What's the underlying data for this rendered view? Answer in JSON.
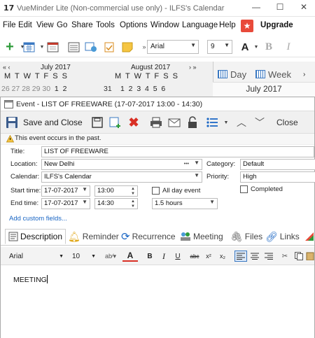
{
  "app": {
    "logo": "17",
    "title": "VueMinder Lite (Non-commercial use only) - ILFS's Calendar",
    "controls": {
      "minimize": "—",
      "maximize": "☐",
      "close": "✕"
    }
  },
  "menu": {
    "items": [
      "File",
      "Edit",
      "View",
      "Go",
      "Share",
      "Tools",
      "Options",
      "Window",
      "Language",
      "Help"
    ],
    "upgrade": "Upgrade",
    "upgrade_color": "#e84a3a"
  },
  "toolbar": {
    "font": "Arial",
    "size": "9",
    "font_color_label": "A",
    "bold_label": "B",
    "italic_label": "I"
  },
  "minical": {
    "months": [
      {
        "title": "July 2017",
        "dow": "M T W T F S S",
        "dates_dim": "26 27 28 29 30",
        "dates": "1  2"
      },
      {
        "title": "August 2017",
        "dow": "M T W T F S S",
        "dates_lead": "31",
        "dates": "1  2  3  4  5  6"
      }
    ],
    "nav_prev": "«  ‹",
    "nav_next": "›  »"
  },
  "view": {
    "day": "Day",
    "week": "Week",
    "month_label": "July 2017"
  },
  "event": {
    "window_title": "Event - LIST OF FREEWARE (17-07-2017 13:00 - 14:30)",
    "toolbar": {
      "save_close": "Save and Close",
      "close": "Close"
    },
    "warning": "This event occurs in the past.",
    "labels": {
      "title": "Title:",
      "location": "Location:",
      "calendar": "Calendar:",
      "start": "Start time:",
      "end": "End time:",
      "category": "Category:",
      "priority": "Priority:",
      "all_day": "All day event",
      "completed": "Completed",
      "add_custom": "Add custom fields..."
    },
    "values": {
      "title": "LIST OF FREEWARE",
      "location": "New Delhi",
      "location_more": "•••",
      "calendar": "ILFS's Calendar",
      "start_date": "17-07-2017",
      "start_time": "13:00",
      "end_date": "17-07-2017",
      "end_time": "14:30",
      "duration": "1.5 hours",
      "category": "Default",
      "priority": "High"
    },
    "tabs": [
      "Description",
      "Reminder",
      "Recurrence",
      "Meeting",
      "Files",
      "Links"
    ],
    "format": {
      "font": "Arial",
      "size": "10",
      "bold": "B",
      "italic": "I",
      "underline": "U",
      "strike": "abc",
      "superscript": "x²",
      "subscript": "x₂",
      "color_label": "A"
    },
    "description": "MEETING"
  }
}
